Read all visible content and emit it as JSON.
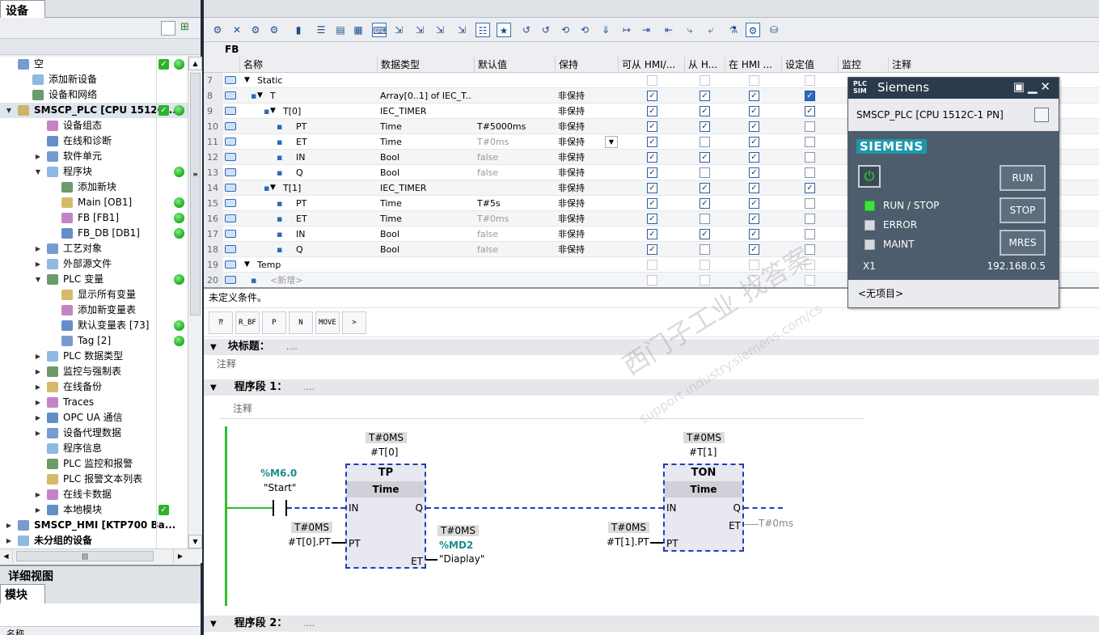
{
  "left": {
    "tab_label": "设备",
    "tree": [
      {
        "label": "空",
        "indent": 0,
        "arrow": "",
        "check": true,
        "dot": true
      },
      {
        "label": "添加新设备",
        "indent": 1,
        "arrow": ""
      },
      {
        "label": "设备和网络",
        "indent": 1,
        "arrow": ""
      },
      {
        "label": "SMSCP_PLC [CPU 1512C-...",
        "indent": 0,
        "arrow": "▼",
        "check": true,
        "dot": true,
        "bold": true,
        "sel": true
      },
      {
        "label": "设备组态",
        "indent": 2,
        "arrow": ""
      },
      {
        "label": "在线和诊断",
        "indent": 2,
        "arrow": ""
      },
      {
        "label": "软件单元",
        "indent": 2,
        "arrow": "▶"
      },
      {
        "label": "程序块",
        "indent": 2,
        "arrow": "▼",
        "dot": true
      },
      {
        "label": "添加新块",
        "indent": 3,
        "arrow": ""
      },
      {
        "label": "Main [OB1]",
        "indent": 3,
        "arrow": "",
        "dot": true
      },
      {
        "label": "FB [FB1]",
        "indent": 3,
        "arrow": "",
        "dot": true
      },
      {
        "label": "FB_DB [DB1]",
        "indent": 3,
        "arrow": "",
        "dot": true
      },
      {
        "label": "工艺对象",
        "indent": 2,
        "arrow": "▶"
      },
      {
        "label": "外部源文件",
        "indent": 2,
        "arrow": "▶"
      },
      {
        "label": "PLC 变量",
        "indent": 2,
        "arrow": "▼",
        "dot": true
      },
      {
        "label": "显示所有变量",
        "indent": 3,
        "arrow": ""
      },
      {
        "label": "添加新变量表",
        "indent": 3,
        "arrow": ""
      },
      {
        "label": "默认变量表 [73]",
        "indent": 3,
        "arrow": "",
        "dot": true
      },
      {
        "label": "Tag [2]",
        "indent": 3,
        "arrow": "",
        "dot": true
      },
      {
        "label": "PLC 数据类型",
        "indent": 2,
        "arrow": "▶"
      },
      {
        "label": "监控与强制表",
        "indent": 2,
        "arrow": "▶"
      },
      {
        "label": "在线备份",
        "indent": 2,
        "arrow": "▶"
      },
      {
        "label": "Traces",
        "indent": 2,
        "arrow": "▶"
      },
      {
        "label": "OPC UA 通信",
        "indent": 2,
        "arrow": "▶"
      },
      {
        "label": "设备代理数据",
        "indent": 2,
        "arrow": "▶"
      },
      {
        "label": "程序信息",
        "indent": 2,
        "arrow": ""
      },
      {
        "label": "PLC 监控和报警",
        "indent": 2,
        "arrow": ""
      },
      {
        "label": "PLC 报警文本列表",
        "indent": 2,
        "arrow": ""
      },
      {
        "label": "在线卡数据",
        "indent": 2,
        "arrow": "▶"
      },
      {
        "label": "本地模块",
        "indent": 2,
        "arrow": "▶",
        "check": true
      },
      {
        "label": "SMSCP_HMI [KTP700 Ba...",
        "indent": 0,
        "arrow": "▶",
        "bold": true
      },
      {
        "label": "未分组的设备",
        "indent": 0,
        "arrow": "▶",
        "bold": true
      }
    ],
    "detail_view_title": "详细视图",
    "module_tab": "模块",
    "module_col": "名称"
  },
  "editor": {
    "block_name": "FB",
    "columns": [
      "名称",
      "数据类型",
      "默认值",
      "保持",
      "可从 HMI/...",
      "从 H...",
      "在 HMI ...",
      "设定值",
      "监控",
      "注释"
    ],
    "rows": [
      {
        "n": "7",
        "name": "Static",
        "indent": 0,
        "tri": "▼",
        "type": "",
        "def": "",
        "keep": "",
        "cb": [
          0,
          0,
          0,
          0
        ],
        "grey": true
      },
      {
        "n": "8",
        "name": "T",
        "indent": 1,
        "tri": "▼",
        "type": "Array[0..1] of IEC_T...",
        "def": "",
        "keep": "非保持",
        "cb": [
          1,
          1,
          1,
          2
        ]
      },
      {
        "n": "9",
        "name": "T[0]",
        "indent": 2,
        "tri": "▼",
        "type": "IEC_TIMER",
        "def": "",
        "keep": "非保持",
        "cb": [
          1,
          1,
          1,
          1
        ]
      },
      {
        "n": "10",
        "name": "PT",
        "indent": 3,
        "tri": "",
        "type": "Time",
        "def": "T#5000ms",
        "keep": "非保持",
        "cb": [
          1,
          1,
          1,
          0
        ]
      },
      {
        "n": "11",
        "name": "ET",
        "indent": 3,
        "tri": "",
        "type": "Time",
        "def": "T#0ms",
        "keep": "非保持",
        "cb": [
          1,
          0,
          1,
          0
        ],
        "dimdef": true,
        "dropdown": true
      },
      {
        "n": "12",
        "name": "IN",
        "indent": 3,
        "tri": "",
        "type": "Bool",
        "def": "false",
        "keep": "非保持",
        "cb": [
          1,
          1,
          1,
          0
        ],
        "dimdef": true
      },
      {
        "n": "13",
        "name": "Q",
        "indent": 3,
        "tri": "",
        "type": "Bool",
        "def": "false",
        "keep": "非保持",
        "cb": [
          1,
          0,
          1,
          0
        ],
        "dimdef": true
      },
      {
        "n": "14",
        "name": "T[1]",
        "indent": 2,
        "tri": "▼",
        "type": "IEC_TIMER",
        "def": "",
        "keep": "非保持",
        "cb": [
          1,
          1,
          1,
          1
        ]
      },
      {
        "n": "15",
        "name": "PT",
        "indent": 3,
        "tri": "",
        "type": "Time",
        "def": "T#5s",
        "keep": "非保持",
        "cb": [
          1,
          1,
          1,
          0
        ]
      },
      {
        "n": "16",
        "name": "ET",
        "indent": 3,
        "tri": "",
        "type": "Time",
        "def": "T#0ms",
        "keep": "非保持",
        "cb": [
          1,
          0,
          1,
          0
        ],
        "dimdef": true
      },
      {
        "n": "17",
        "name": "IN",
        "indent": 3,
        "tri": "",
        "type": "Bool",
        "def": "false",
        "keep": "非保持",
        "cb": [
          1,
          1,
          1,
          0
        ],
        "dimdef": true
      },
      {
        "n": "18",
        "name": "Q",
        "indent": 3,
        "tri": "",
        "type": "Bool",
        "def": "false",
        "keep": "非保持",
        "cb": [
          1,
          0,
          1,
          0
        ],
        "dimdef": true
      },
      {
        "n": "19",
        "name": "Temp",
        "indent": 0,
        "tri": "▼",
        "type": "",
        "def": "",
        "keep": "",
        "cb": [
          0,
          0,
          0,
          0
        ],
        "grey": true
      },
      {
        "n": "20",
        "name": "<新增>",
        "indent": 1,
        "tri": "",
        "type": "",
        "def": "",
        "keep": "",
        "cb": [
          0,
          0,
          0,
          0
        ],
        "grey": true,
        "dimname": true
      }
    ],
    "condition_text": "未定义条件。",
    "ladder_buttons": [
      "⁇",
      "R_BF",
      "P",
      "N",
      "MOVE",
      ">"
    ],
    "block_title_label": "块标题：",
    "block_title_dots": "....",
    "comment_label": "注释",
    "network1_label": "程序段 1：",
    "network1_dots": "....",
    "network2_label": "程序段 2：",
    "network2_dots": "....",
    "ladder": {
      "tp_instance_val": "T#0MS",
      "tp_instance": "#T[0]",
      "tp_name": "TP",
      "tp_type": "Time",
      "contact_addr": "%M6.0",
      "contact_name": "\"Start\"",
      "tp_pt_val": "T#0MS",
      "tp_pt_name": "#T[0].PT",
      "tp_et_val": "T#0MS",
      "tp_et_addr": "%MD2",
      "tp_et_name": "\"Diaplay\"",
      "ton_instance_val": "T#0MS",
      "ton_instance": "#T[1]",
      "ton_name": "TON",
      "ton_type": "Time",
      "ton_pt_val": "T#0MS",
      "ton_pt_name": "#T[1].PT",
      "ton_et_val": "T#0ms",
      "pin_in": "IN",
      "pin_q": "Q",
      "pin_pt": "PT",
      "pin_et": "ET"
    }
  },
  "plcsim": {
    "title": "Siemens",
    "logo": "PLC SIM",
    "device": "SMSCP_PLC [CPU 1512C-1 PN]",
    "brand": "SIEMENS",
    "leds": [
      {
        "label": "RUN / STOP",
        "on": true
      },
      {
        "label": "ERROR",
        "on": false
      },
      {
        "label": "MAINT",
        "on": false
      }
    ],
    "buttons": [
      "RUN",
      "STOP",
      "MRES"
    ],
    "port": "X1",
    "ip": "192.168.0.5",
    "footer": "<无项目>"
  },
  "watermark": "西门子工业 找答案",
  "watermark_url": "support.industry.siemens.com/cs",
  "colors": {
    "accent": "#1d3fb5",
    "ok": "#2cb32c",
    "sim_bg": "#4d5d6d"
  }
}
